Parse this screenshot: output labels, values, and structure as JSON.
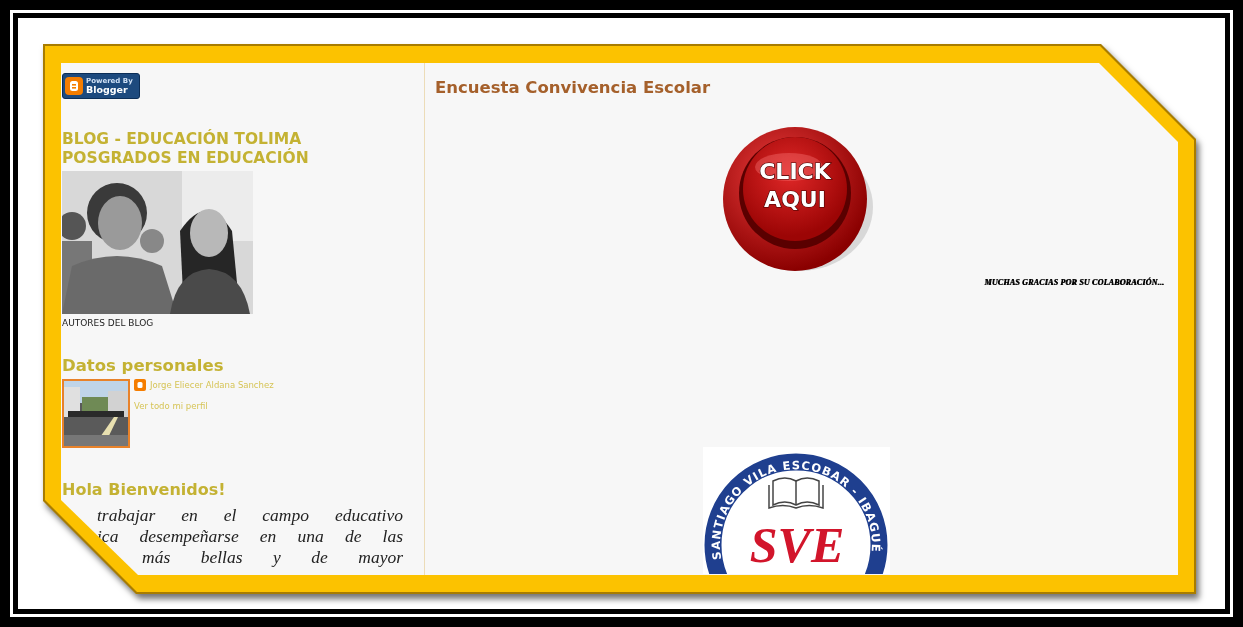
{
  "sidebar": {
    "badge": {
      "line_1": "Powered By",
      "line_2": "Blogger"
    },
    "blog_title_lines": [
      "BLOG - EDUCACIÓN TOLIMA",
      "POSGRADOS EN EDUCACIÓN"
    ],
    "photo": {
      "kind": "picture"
    },
    "photo_caption": "AUTORES DEL BLOG",
    "profile": {
      "heading": "Datos personales",
      "name": "Jorge Eliecer Aldana Sanchez",
      "profile_link": "Ver todo mi perfil"
    },
    "welcome": {
      "heading": "Hola Bienvenidos!",
      "lines": [
        "trabajar en el campo educativo",
        "ica desempeñarse en una de las",
        "más bellas y de mayor"
      ]
    }
  },
  "post": {
    "title": "Encuesta Convivencia Escolar",
    "button_lines": [
      "CLICK",
      "AQUI"
    ],
    "thanks": "MUCHAS GRACIAS POR SU COLABORACIÓN...",
    "logo": {
      "arc_text": "SANTIAGO VILA ESCOBAR - IBAGUÉ",
      "initials": "SVE"
    }
  }
}
